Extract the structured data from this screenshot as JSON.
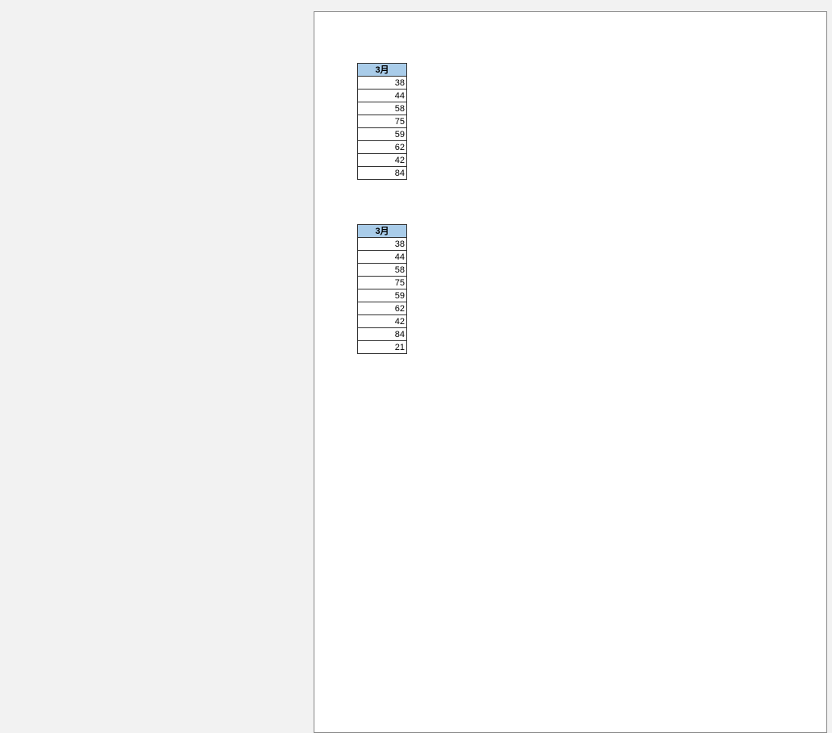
{
  "tables": [
    {
      "header": "3月",
      "rows": [
        38,
        44,
        58,
        75,
        59,
        62,
        42,
        84
      ]
    },
    {
      "header": "3月",
      "rows": [
        38,
        44,
        58,
        75,
        59,
        62,
        42,
        84,
        21
      ]
    }
  ]
}
